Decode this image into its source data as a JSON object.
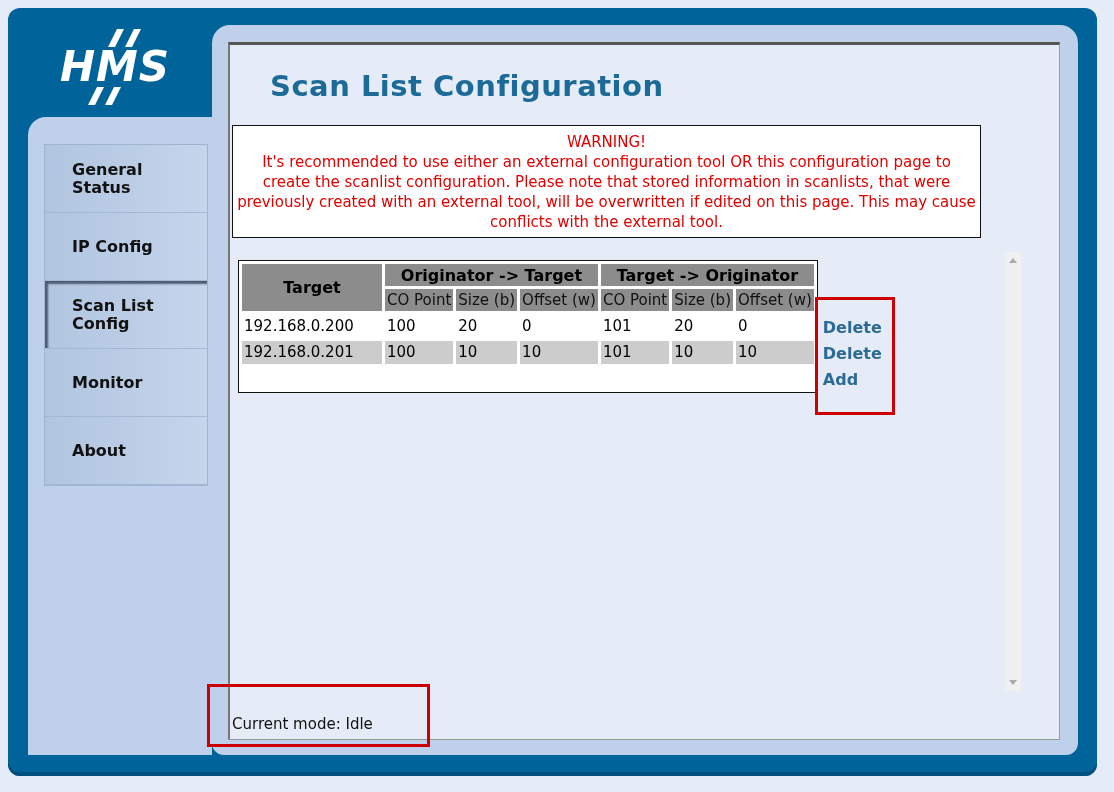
{
  "logo": {
    "text": "HMS"
  },
  "nav": {
    "items": [
      {
        "label": "General Status",
        "selected": false
      },
      {
        "label": "IP Config",
        "selected": false
      },
      {
        "label": "Scan List Config",
        "selected": true
      },
      {
        "label": "Monitor",
        "selected": false
      },
      {
        "label": "About",
        "selected": false
      }
    ]
  },
  "page_title": "Scan List Configuration",
  "warning": {
    "heading": "WARNING!",
    "message": "It's recommended to use either an external configuration tool OR this configuration page to create the scanlist configuration. Please note that stored information in scanlists, that were previously created with an external tool, will be overwritten if edited on this page. This may cause conflicts with the external tool."
  },
  "table": {
    "first_column": "Target",
    "column_groups": [
      {
        "label": "Originator -> Target",
        "columns": [
          "CO Point",
          "Size (b)",
          "Offset (w)"
        ]
      },
      {
        "label": "Target -> Originator",
        "columns": [
          "CO Point",
          "Size (b)",
          "Offset (w)"
        ]
      }
    ],
    "rows": [
      {
        "cells": [
          "192.168.0.200",
          "100",
          "20",
          "0",
          "101",
          "20",
          "0"
        ],
        "action": "Delete"
      },
      {
        "cells": [
          "192.168.0.201",
          "100",
          "10",
          "10",
          "101",
          "10",
          "10"
        ],
        "action": "Delete"
      }
    ],
    "add_link": "Add"
  },
  "status": "Current mode: Idle"
}
